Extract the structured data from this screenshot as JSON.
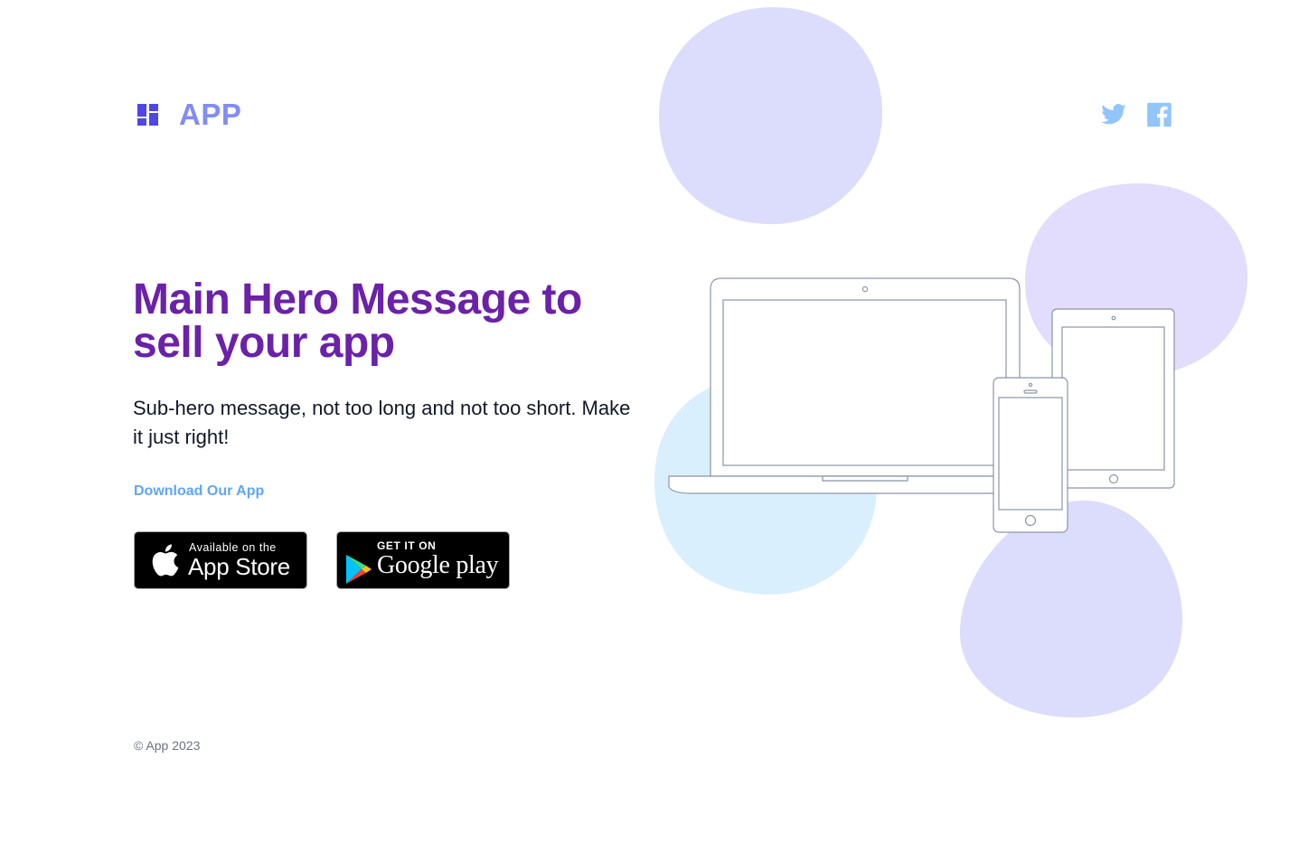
{
  "brand": {
    "name": "APP",
    "icon": "dashboard-grid-icon"
  },
  "social": [
    {
      "name": "twitter",
      "icon": "twitter-icon"
    },
    {
      "name": "facebook",
      "icon": "facebook-icon"
    }
  ],
  "hero": {
    "title": "Main Hero Message to sell your app",
    "subtitle": "Sub-hero message, not too long and not too short. Make it just right!"
  },
  "download": {
    "label": "Download Our App",
    "app_store": {
      "small": "Available on the",
      "big": "App Store",
      "icon": "apple-icon"
    },
    "google_play": {
      "small": "GET IT ON",
      "big": "Google play",
      "icon": "google-play-icon"
    }
  },
  "footer": {
    "copyright": "© App 2023"
  },
  "colors": {
    "accent": "#818cf8",
    "hero_title": "#6b21a8",
    "link": "#60a5fa",
    "blob_indigo": "#e0e7ff",
    "blob_purple": "#ede9fe",
    "blob_sky": "#e0f2fe",
    "social": "#93c5fd"
  }
}
